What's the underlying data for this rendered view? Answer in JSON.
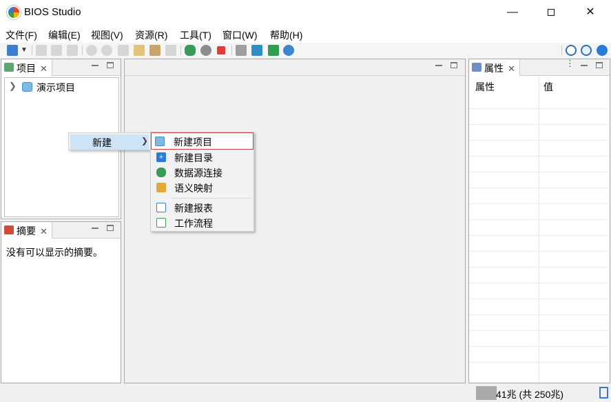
{
  "window": {
    "title": "BIOS Studio",
    "minimize_icon": "minimize-icon",
    "maximize_icon": "maximize-icon",
    "close_icon": "close-icon"
  },
  "menubar": {
    "items": [
      "文件(F)",
      "编辑(E)",
      "视图(V)",
      "资源(R)",
      "工具(T)",
      "窗口(W)",
      "帮助(H)"
    ]
  },
  "projects_panel": {
    "tab_label": "项目",
    "tree": [
      {
        "label": "演示项目",
        "expanded": false
      }
    ]
  },
  "summary_panel": {
    "tab_label": "摘要",
    "empty_text": "没有可以显示的摘要。"
  },
  "properties_panel": {
    "tab_label": "属性",
    "col_property": "属性",
    "col_value": "值"
  },
  "context_menu": {
    "parent_label": "新建",
    "items": [
      {
        "label": "新建项目",
        "icon": "project-icon"
      },
      {
        "label": "新建目录",
        "icon": "folder-add-icon"
      },
      {
        "label": "数据源连接",
        "icon": "database-connect-icon"
      },
      {
        "label": "语义映射",
        "icon": "semantic-mapping-icon"
      },
      {
        "label": "新建报表",
        "icon": "report-icon"
      },
      {
        "label": "工作流程",
        "icon": "workflow-icon"
      }
    ]
  },
  "status": {
    "memory_text": "41兆 (共 250兆)"
  },
  "colors": {
    "accent": "#2a7ad9",
    "menu_highlight": "#cde4f7",
    "hover_border": "#d43d3d"
  }
}
